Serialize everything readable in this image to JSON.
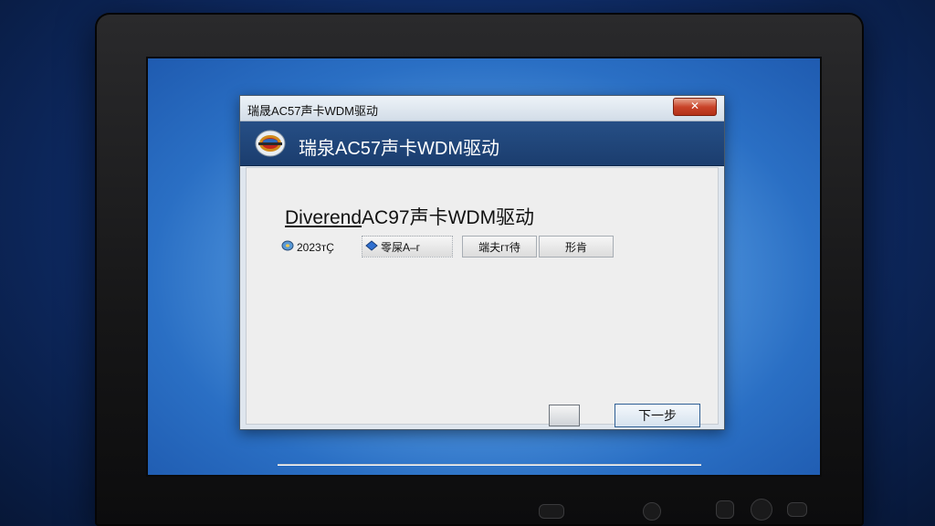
{
  "window": {
    "title": "瑞晟AC57声卡WDM驱动",
    "close_glyph": "✕"
  },
  "banner": {
    "heading": "瑞泉AC57声卡WDM驱动",
    "logo_icon": "circular-logo-icon"
  },
  "main": {
    "product_prefix": "Diverend",
    "product_suffix": "AC97声卡WDM驱动",
    "chips": [
      {
        "label": "2023тҪ",
        "icon": "disc-icon"
      },
      {
        "label": "零屎A–г",
        "icon": "diamond-icon"
      },
      {
        "label": "端夫гт待",
        "icon": ""
      },
      {
        "label": "形肯",
        "icon": ""
      }
    ]
  },
  "footer": {
    "next_label": "下一步"
  }
}
